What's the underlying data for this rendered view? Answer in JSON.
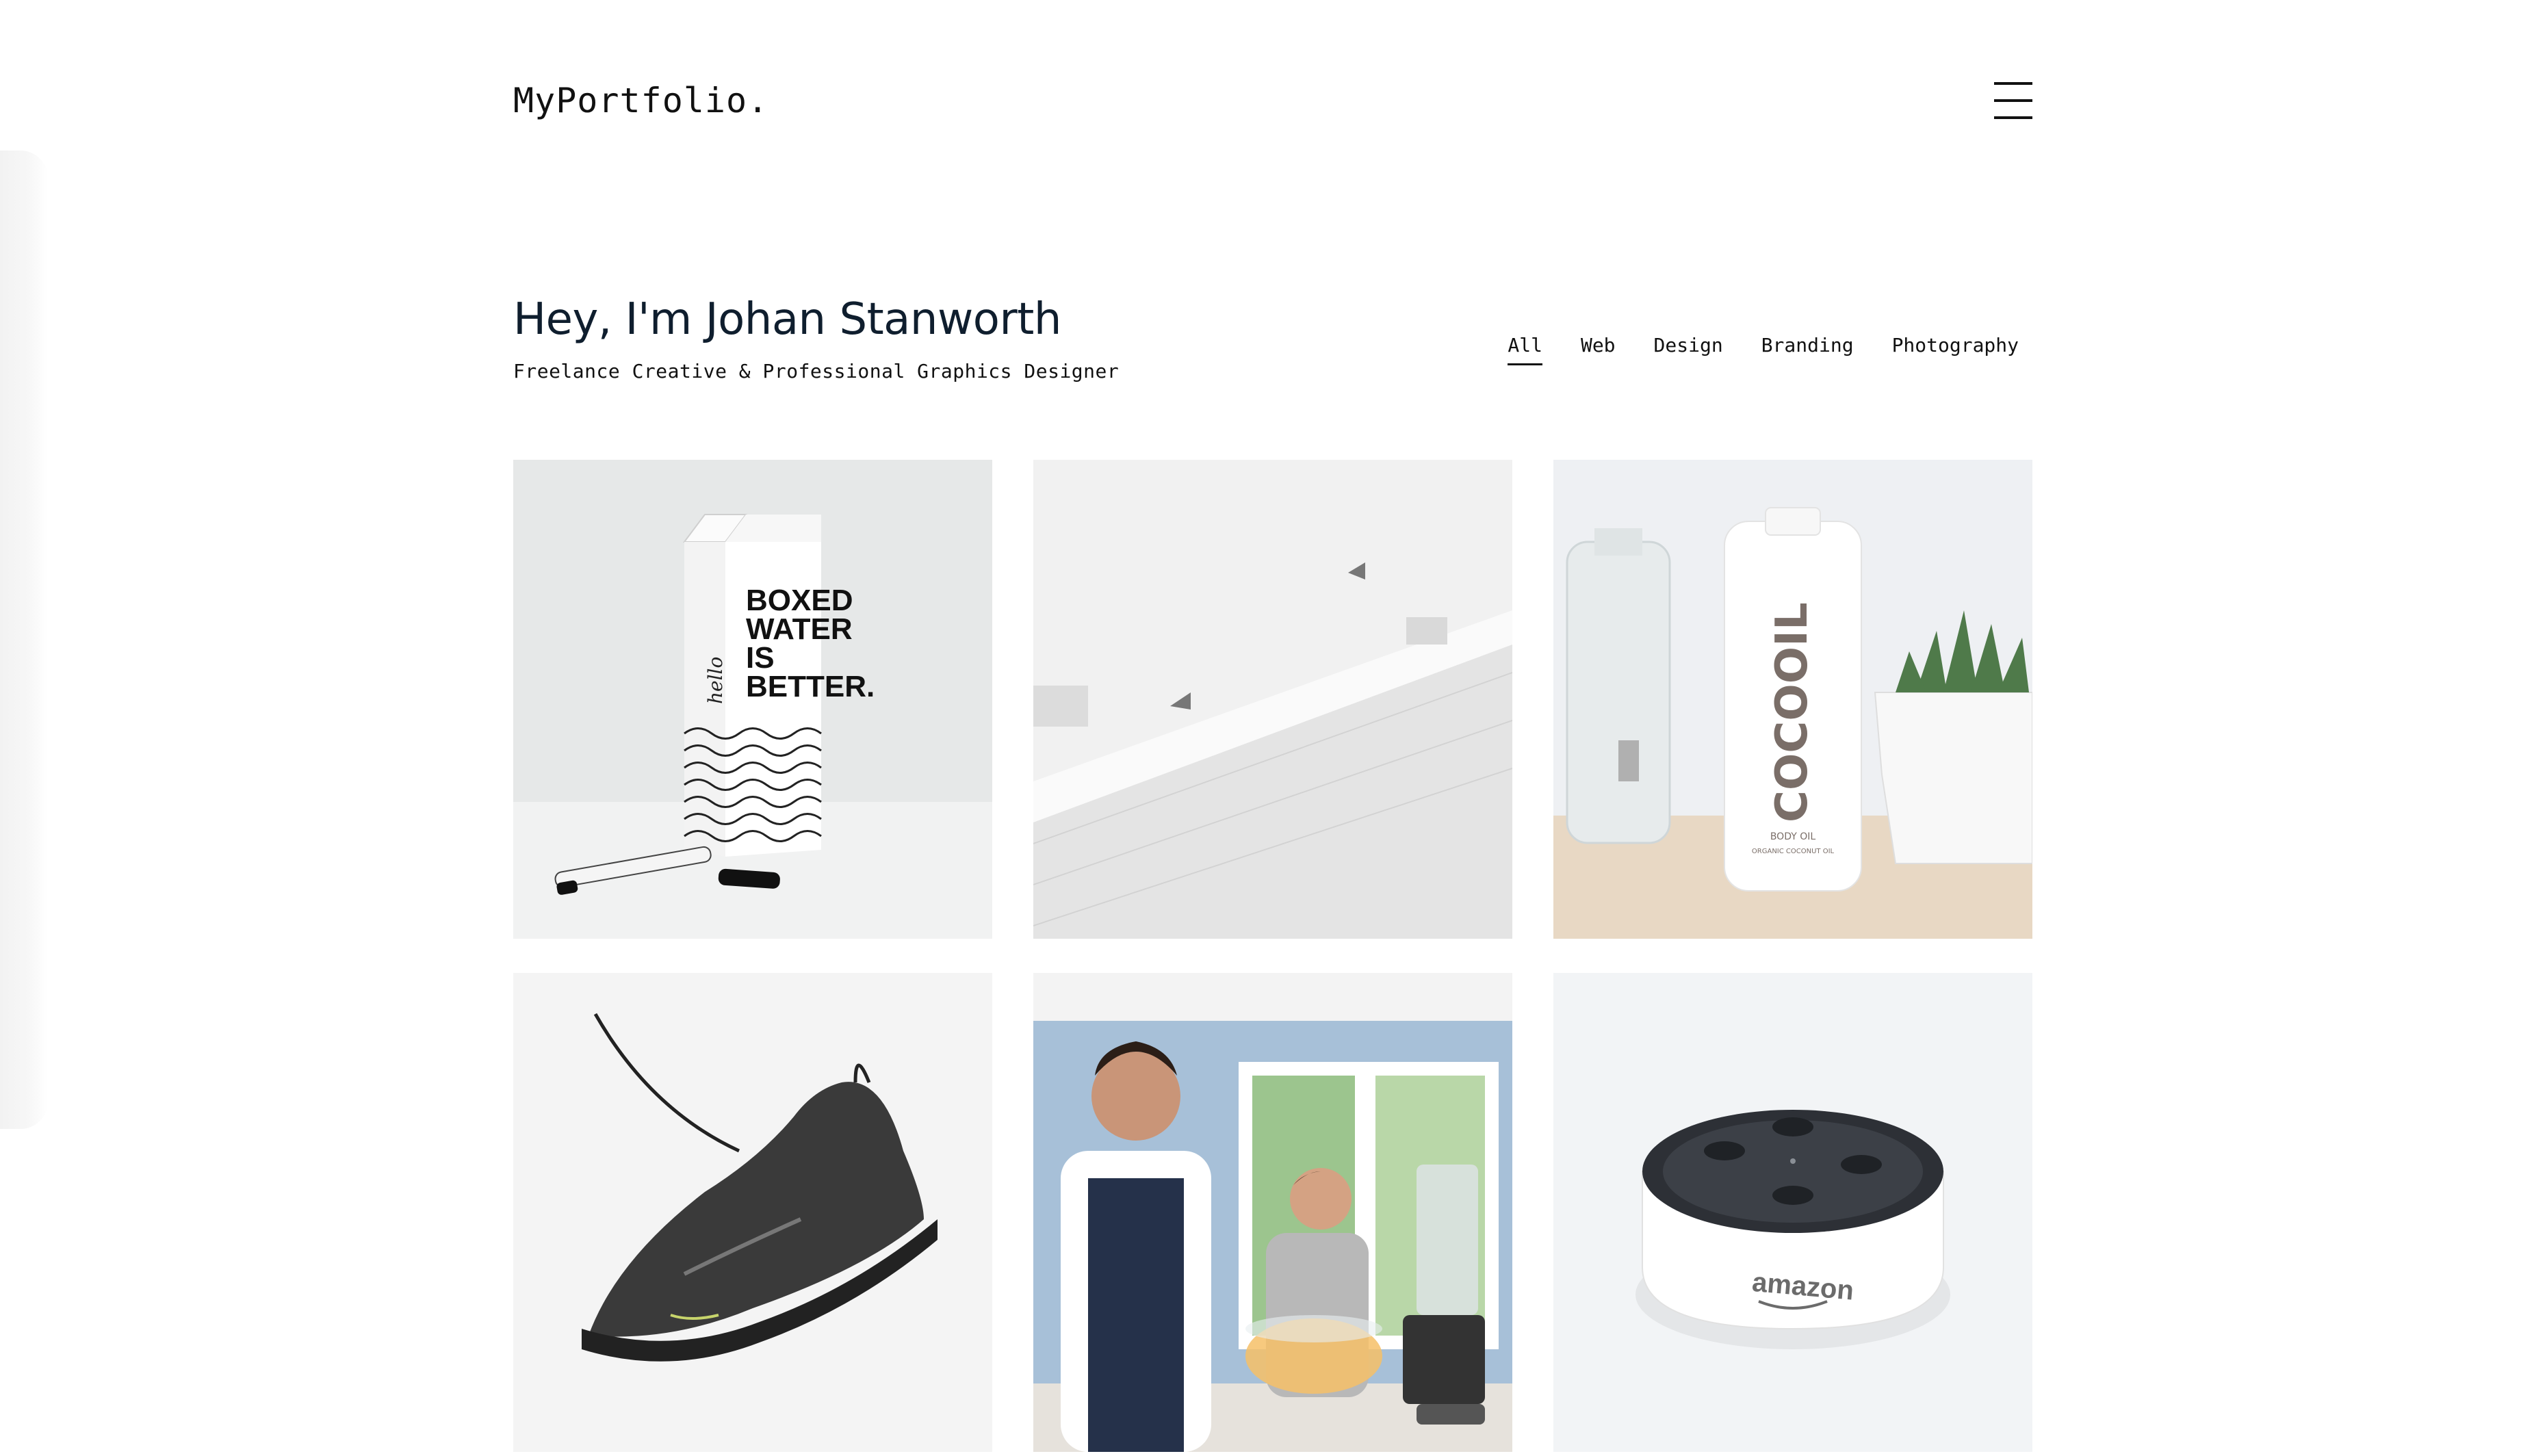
{
  "header": {
    "logo": "MyPortfolio.",
    "menu_icon": "hamburger-menu-icon"
  },
  "intro": {
    "title": "Hey, I'm Johan Stanworth",
    "subtitle": "Freelance Creative & Professional Graphics Designer"
  },
  "filters": {
    "active": "All",
    "items": [
      {
        "label": "All"
      },
      {
        "label": "Web"
      },
      {
        "label": "Design"
      },
      {
        "label": "Branding"
      },
      {
        "label": "Photography"
      }
    ]
  },
  "portfolio": {
    "items": [
      {
        "subject": "boxed-water-carton",
        "carton_lines": [
          "BOXED",
          "WATER",
          "IS",
          "BETTER."
        ],
        "carton_script": "hello"
      },
      {
        "subject": "white-architecture"
      },
      {
        "subject": "cocooil-bottle",
        "brand": "COCOOIL",
        "label_lines": [
          "BODY OIL",
          "ORGANIC COCONUT OIL"
        ]
      },
      {
        "subject": "floating-sneaker"
      },
      {
        "subject": "kitchen-blender-family"
      },
      {
        "subject": "amazon-echo-dot",
        "brand": "amazon"
      }
    ]
  },
  "colors": {
    "text": "#111111",
    "heading": "#0f1e2e",
    "background": "#ffffff"
  }
}
